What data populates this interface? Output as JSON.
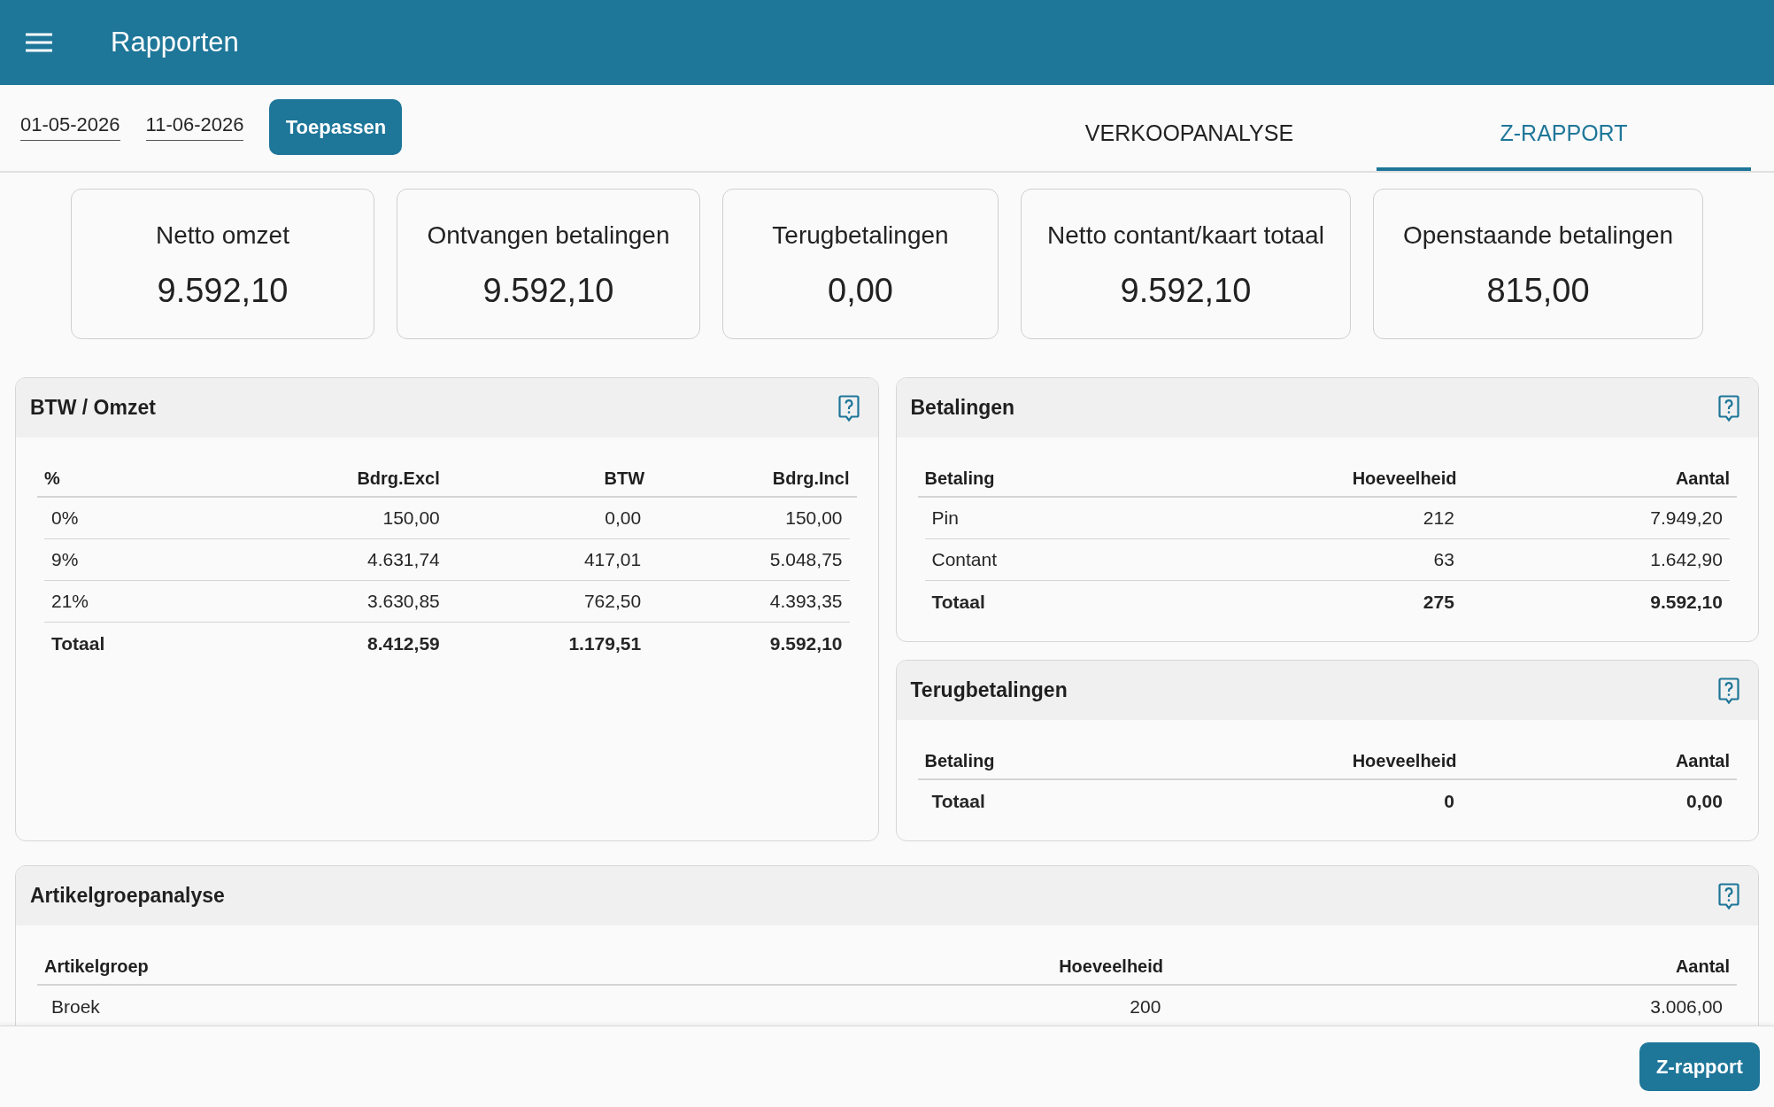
{
  "app_bar": {
    "title": "Rapporten"
  },
  "date_range": {
    "start": "01-05-2026",
    "end": "11-06-2026"
  },
  "apply_button": "Toepassen",
  "tabs": [
    {
      "label": "VERKOOPANALYSE",
      "selected": false
    },
    {
      "label": "Z-RAPPORT",
      "selected": true
    }
  ],
  "summary_cards": [
    {
      "label": "Netto omzet",
      "value": "9.592,10"
    },
    {
      "label": "Ontvangen betalingen",
      "value": "9.592,10"
    },
    {
      "label": "Terugbetalingen",
      "value": "0,00"
    },
    {
      "label": "Netto contant/kaart totaal",
      "value": "9.592,10"
    },
    {
      "label": "Openstaande betalingen",
      "value": "815,00"
    }
  ],
  "panels": [
    {
      "title": "BTW / Omzet",
      "columns": [
        "%",
        "Bdrg.Excl",
        "BTW",
        "Bdrg.Incl"
      ],
      "rows": [
        {
          "kind": "item",
          "cells": [
            "0%",
            "150,00",
            "0,00",
            "150,00"
          ]
        },
        {
          "kind": "item",
          "cells": [
            "9%",
            "4.631,74",
            "417,01",
            "5.048,75"
          ]
        },
        {
          "kind": "item",
          "cells": [
            "21%",
            "3.630,85",
            "762,50",
            "4.393,35"
          ]
        },
        {
          "kind": "total",
          "cells": [
            "Totaal",
            "8.412,59",
            "1.179,51",
            "9.592,10"
          ]
        }
      ]
    },
    {
      "title": "Betalingen",
      "columns": [
        "Betaling",
        "Hoeveelheid",
        "Aantal"
      ],
      "rows": [
        {
          "kind": "item",
          "cells": [
            "Pin",
            "212",
            "7.949,20"
          ]
        },
        {
          "kind": "item",
          "cells": [
            "Contant",
            "63",
            "1.642,90"
          ]
        },
        {
          "kind": "total",
          "cells": [
            "Totaal",
            "275",
            "9.592,10"
          ]
        }
      ]
    },
    {
      "title": "Terugbetalingen",
      "columns": [
        "Betaling",
        "Hoeveelheid",
        "Aantal"
      ],
      "rows": [
        {
          "kind": "total",
          "cells": [
            "Totaal",
            "0",
            "0,00"
          ]
        }
      ]
    },
    {
      "title": "Artikelgroepanalyse",
      "columns": [
        "Artikelgroep",
        "Hoeveelheid",
        "Aantal"
      ],
      "rows": [
        {
          "kind": "item",
          "cells": [
            "Broek",
            "200",
            "3.006,00"
          ]
        }
      ]
    }
  ],
  "footer": {
    "button": "Z-rapport"
  }
}
